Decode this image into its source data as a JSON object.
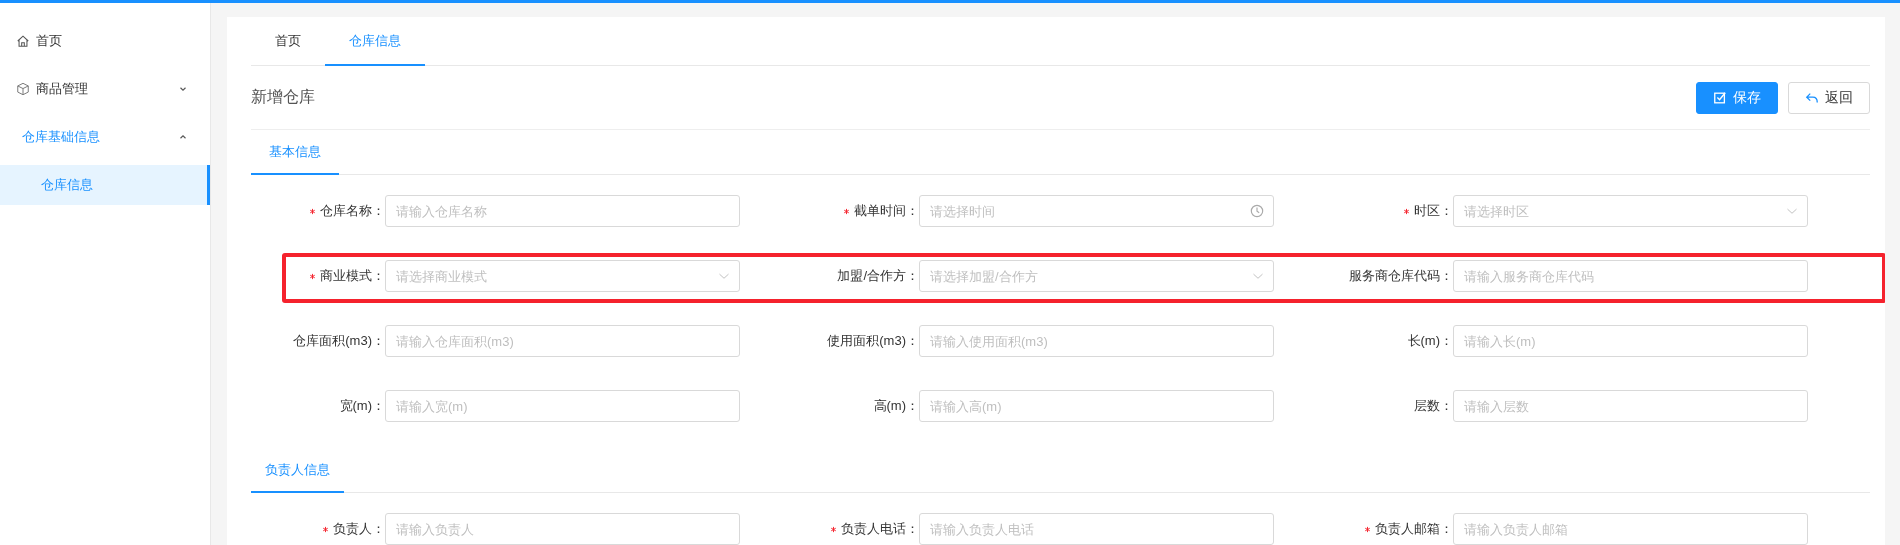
{
  "sidebar": {
    "items": [
      {
        "label": "首页",
        "selected": false
      },
      {
        "label": "商品管理",
        "expanded": false,
        "selected": false
      },
      {
        "label": "仓库基础信息",
        "expanded": true,
        "selected": true,
        "children": [
          {
            "label": "仓库信息",
            "selected": true
          }
        ]
      }
    ]
  },
  "tabs": [
    {
      "label": "首页",
      "selected": false
    },
    {
      "label": "仓库信息",
      "selected": true
    }
  ],
  "page_title": "新增仓库",
  "buttons": [
    {
      "label": "保存",
      "kind": "primary"
    },
    {
      "label": "返回",
      "kind": "default"
    }
  ],
  "sections": [
    {
      "title": "基本信息",
      "rows": [
        {
          "highlighted": false,
          "fields": [
            {
              "label": "仓库名称：",
              "required": true,
              "kind": "input",
              "placeholder": "请输入仓库名称"
            },
            {
              "label": "截单时间：",
              "required": true,
              "kind": "time",
              "placeholder": "请选择时间"
            },
            {
              "label": "时区：",
              "required": true,
              "kind": "select",
              "placeholder": "请选择时区"
            }
          ]
        },
        {
          "highlighted": true,
          "fields": [
            {
              "label": "商业模式：",
              "required": true,
              "kind": "select",
              "placeholder": "请选择商业模式"
            },
            {
              "label": "加盟/合作方：",
              "required": false,
              "kind": "select",
              "placeholder": "请选择加盟/合作方"
            },
            {
              "label": "服务商仓库代码：",
              "required": false,
              "kind": "input",
              "placeholder": "请输入服务商仓库代码"
            }
          ]
        },
        {
          "highlighted": false,
          "fields": [
            {
              "label": "仓库面积(m3)：",
              "required": false,
              "kind": "input",
              "placeholder": "请输入仓库面积(m3)"
            },
            {
              "label": "使用面积(m3)：",
              "required": false,
              "kind": "input",
              "placeholder": "请输入使用面积(m3)"
            },
            {
              "label": "长(m)：",
              "required": false,
              "kind": "input",
              "placeholder": "请输入长(m)"
            }
          ]
        },
        {
          "highlighted": false,
          "fields": [
            {
              "label": "宽(m)：",
              "required": false,
              "kind": "input",
              "placeholder": "请输入宽(m)"
            },
            {
              "label": "高(m)：",
              "required": false,
              "kind": "input",
              "placeholder": "请输入高(m)"
            },
            {
              "label": "层数：",
              "required": false,
              "kind": "input",
              "placeholder": "请输入层数"
            }
          ]
        }
      ]
    },
    {
      "title": "负责人信息",
      "rows": [
        {
          "highlighted": false,
          "fields": [
            {
              "label": "负责人：",
              "required": true,
              "kind": "input",
              "placeholder": "请输入负责人"
            },
            {
              "label": "负责人电话：",
              "required": true,
              "kind": "input",
              "placeholder": "请输入负责人电话"
            },
            {
              "label": "负责人邮箱：",
              "required": true,
              "kind": "input",
              "placeholder": "请输入负责人邮箱"
            }
          ]
        }
      ]
    }
  ]
}
